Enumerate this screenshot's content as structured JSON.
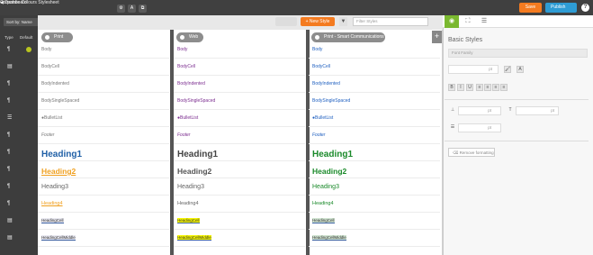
{
  "topbar": {
    "back_label": "◀ Dashboard",
    "title": "Corporate Colours Stylesheet",
    "save_label": "Save",
    "publish_label": "Publish",
    "help_label": "?"
  },
  "left": {
    "sort_label": "Sort by: Name",
    "header_type": "Type",
    "header_default": "Default"
  },
  "toolbar": {
    "new_style_label": "+ New Style",
    "filter_placeholder": "Filter Styles"
  },
  "columns": [
    {
      "name": "Print"
    },
    {
      "name": "Web"
    },
    {
      "name": "Print - Smart Communications"
    }
  ],
  "styles": [
    {
      "type_icon": "¶",
      "default": true,
      "labels": [
        "Body",
        "Body",
        "Body"
      ]
    },
    {
      "type_icon": "▤",
      "default": false,
      "labels": [
        "BodyCell",
        "BodyCell",
        "BodyCell"
      ]
    },
    {
      "type_icon": "¶",
      "default": false,
      "labels": [
        "BodyIndented",
        "BodyIndented",
        "BodyIndented"
      ]
    },
    {
      "type_icon": "¶",
      "default": false,
      "labels": [
        "BodySingleSpaced",
        "BodySingleSpaced",
        "BodySingleSpaced"
      ]
    },
    {
      "type_icon": "☰",
      "default": false,
      "labels": [
        "●BulletList",
        "●BulletList",
        "●BulletList"
      ]
    },
    {
      "type_icon": "¶",
      "default": false,
      "labels": [
        "Footer",
        "Footer",
        "Footer"
      ]
    },
    {
      "type_icon": "¶",
      "default": false,
      "labels": [
        "Heading1",
        "Heading1",
        "Heading1"
      ]
    },
    {
      "type_icon": "¶",
      "default": false,
      "labels": [
        "Heading2",
        "Heading2",
        "Heading2"
      ]
    },
    {
      "type_icon": "¶",
      "default": false,
      "labels": [
        "Heading3",
        "Heading3",
        "Heading3"
      ]
    },
    {
      "type_icon": "¶",
      "default": false,
      "labels": [
        "Heading4",
        "Heading4",
        "Heading4"
      ]
    },
    {
      "type_icon": "▤",
      "default": false,
      "labels": [
        "HeadingCell",
        "HeadingCell",
        "HeadingCell"
      ]
    },
    {
      "type_icon": "▤",
      "default": false,
      "labels": [
        "HeadingCellMiddle",
        "HeadingCellMiddle",
        "HeadingCellMiddle"
      ]
    }
  ],
  "right": {
    "section_title": "Basic Styles",
    "font_family_placeholder": "Font Family",
    "size_unit": "pt",
    "bold": "B",
    "italic": "I",
    "underline": "U",
    "remove_formatting": "Remove formatting"
  },
  "colors": {
    "accent_orange": "#f47b20",
    "publish_blue": "#2e9cd4",
    "tab_green": "#7ab82f",
    "heading_blue": "#1f5fa6",
    "heading_orange": "#f0a020",
    "heading_green": "#1a8a2a",
    "link_purple": "#7b2c8f",
    "link_blue": "#2060c0",
    "highlight_yellow": "#f5f500"
  }
}
